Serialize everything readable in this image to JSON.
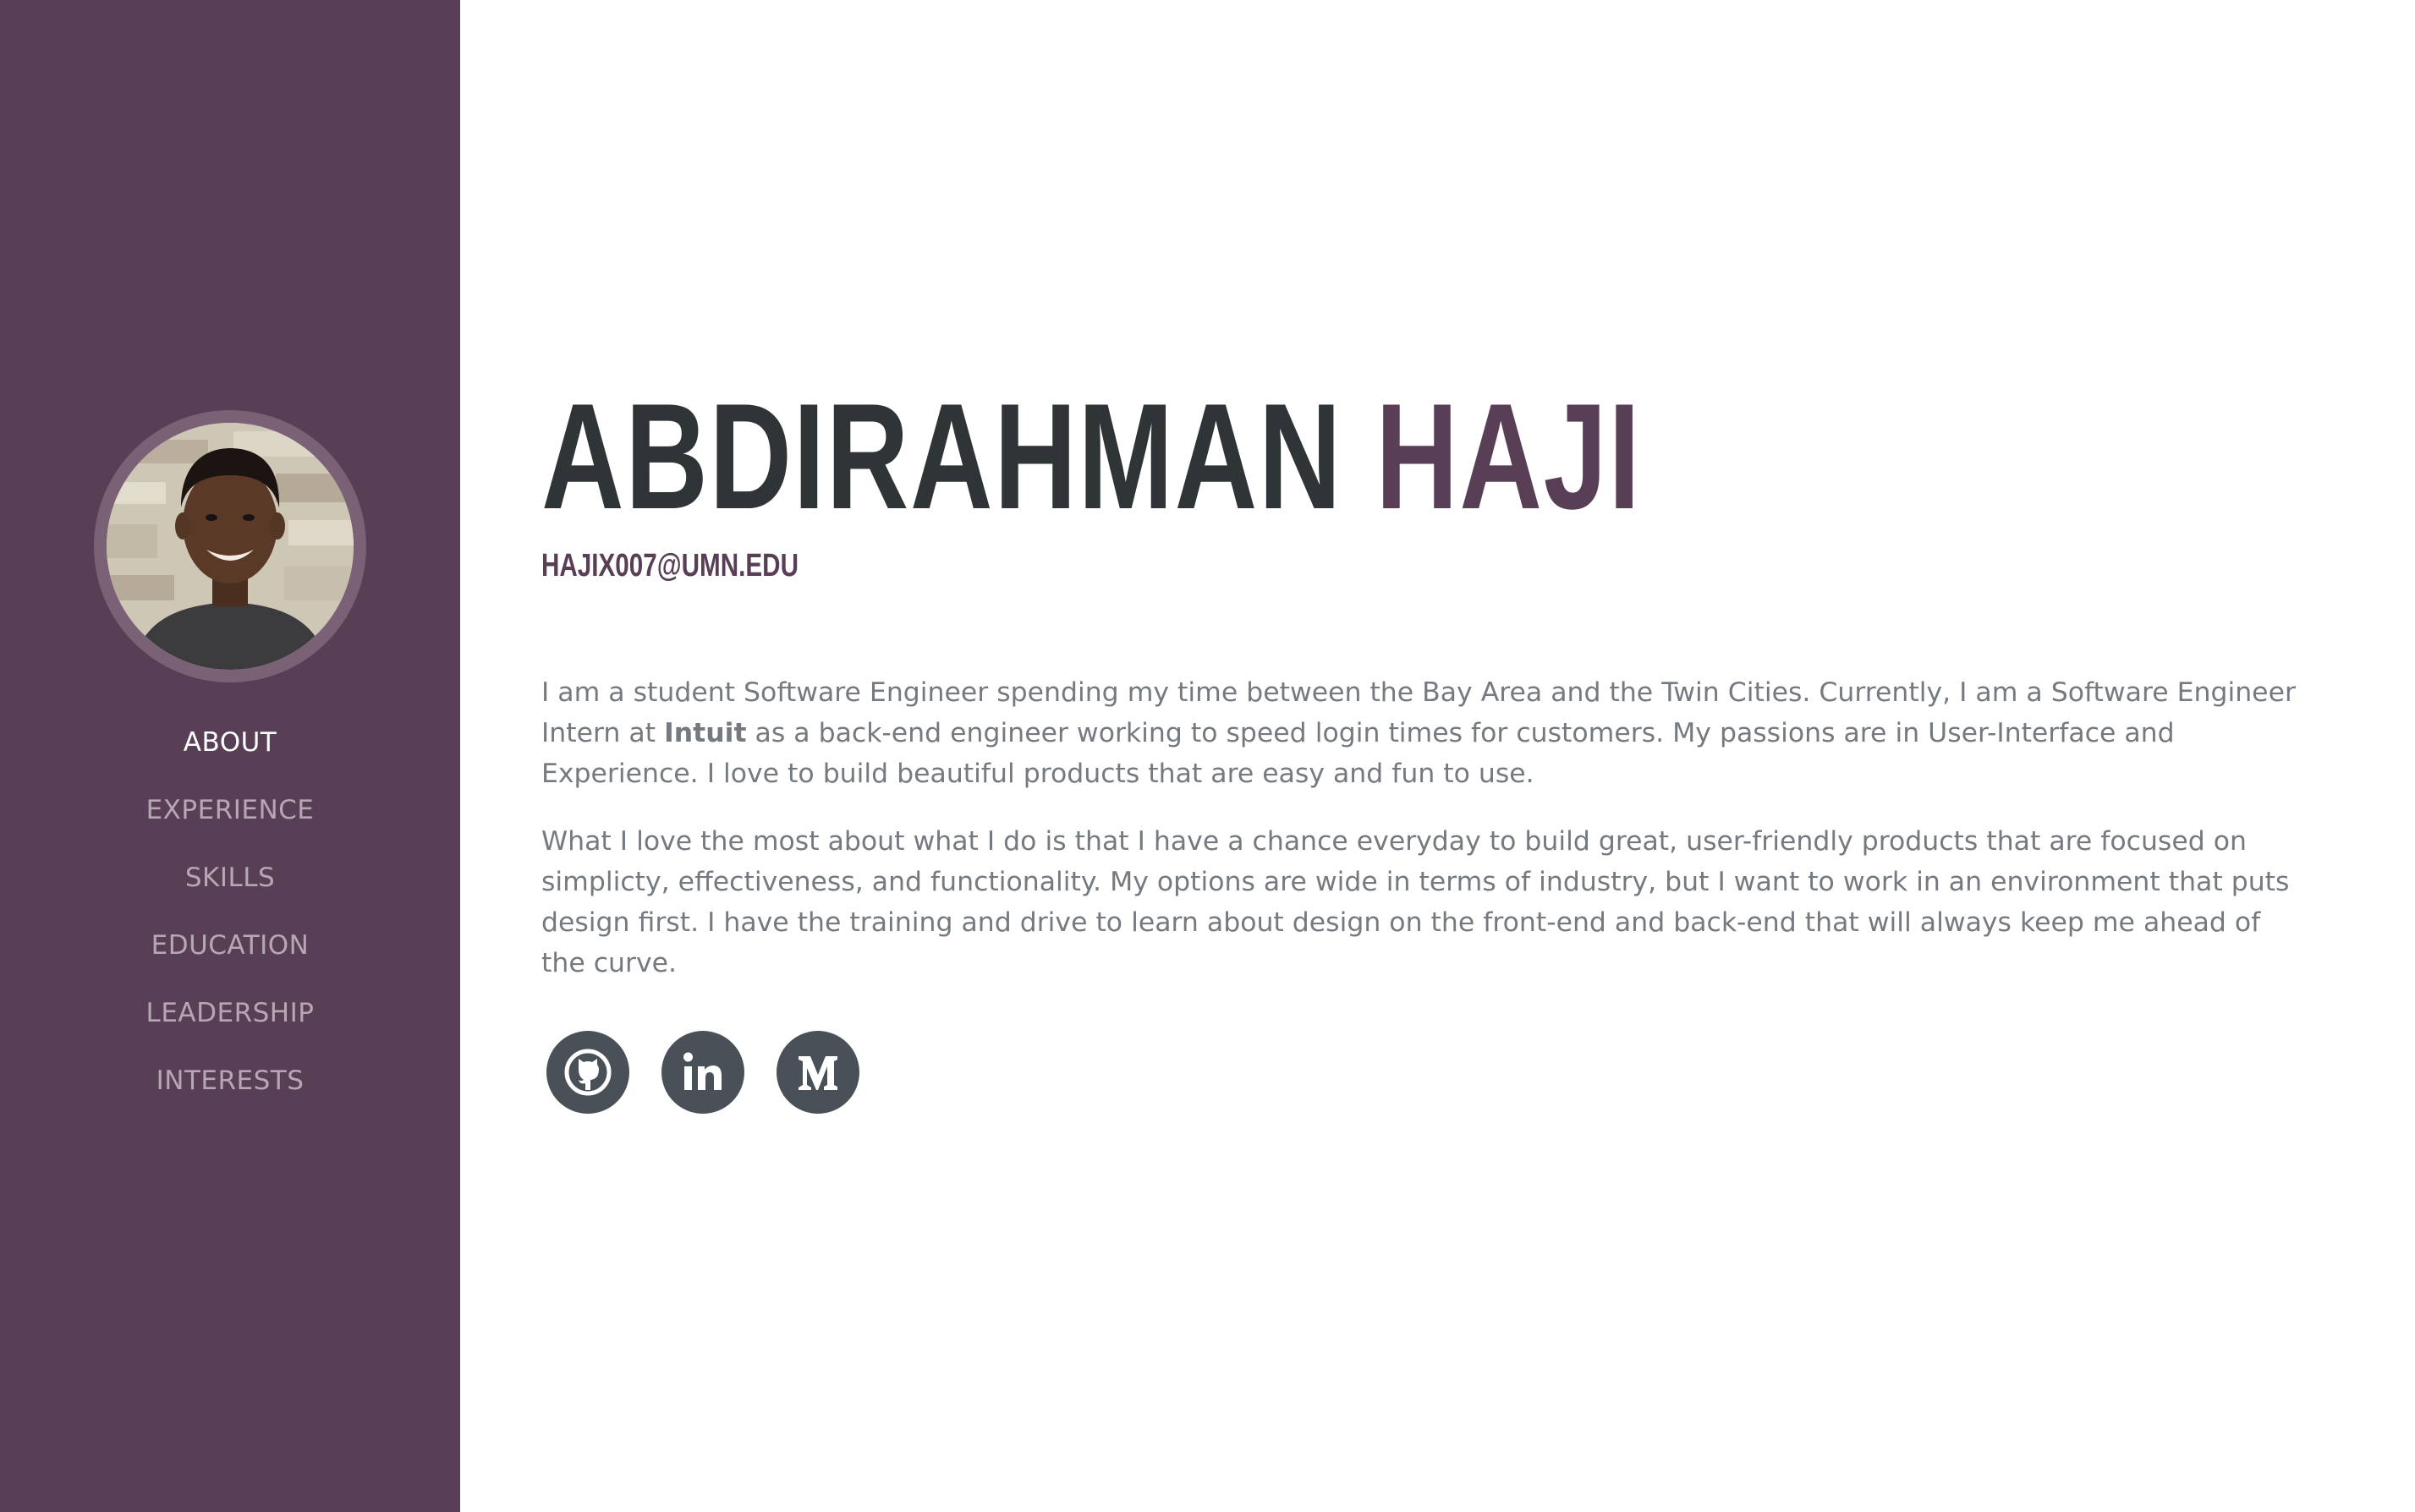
{
  "sidebar": {
    "avatar_alt": "Profile photo",
    "nav": [
      {
        "label": "ABOUT",
        "active": true
      },
      {
        "label": "EXPERIENCE",
        "active": false
      },
      {
        "label": "SKILLS",
        "active": false
      },
      {
        "label": "EDUCATION",
        "active": false
      },
      {
        "label": "LEADERSHIP",
        "active": false
      },
      {
        "label": "INTERESTS",
        "active": false
      }
    ]
  },
  "header": {
    "first_name": "ABDIRAHMAN",
    "last_name": "HAJI",
    "email": "HAJIX007@UMN.EDU"
  },
  "bio": {
    "p1_before": "I am a student Software Engineer spending my time between the Bay Area and the Twin Cities. Currently, I am a Software Engineer Intern at ",
    "p1_company": "Intuit",
    "p1_after": " as a back-end engineer working to speed login times for customers. My passions are in User-Interface and Experience. I love to build beautiful products that are easy and fun to use.",
    "p2": "What I love the most about what I do is that I have a chance everyday to build great, user-friendly products that are focused on simplicty, effectiveness, and functionality. My options are wide in terms of industry, but I want to work in an environment that puts design first. I have the training and drive to learn about design on the front-end and back-end that will always keep me ahead of the curve."
  },
  "socials": [
    {
      "icon": "github-icon"
    },
    {
      "icon": "linkedin-icon"
    },
    {
      "icon": "medium-icon"
    }
  ],
  "colors": {
    "sidebar_bg": "#583f55",
    "accent": "#583f55",
    "heading_dark": "#2f3437",
    "body_text": "#747a80",
    "nav_inactive": "#b7a6b3",
    "social_bg": "#495057"
  }
}
